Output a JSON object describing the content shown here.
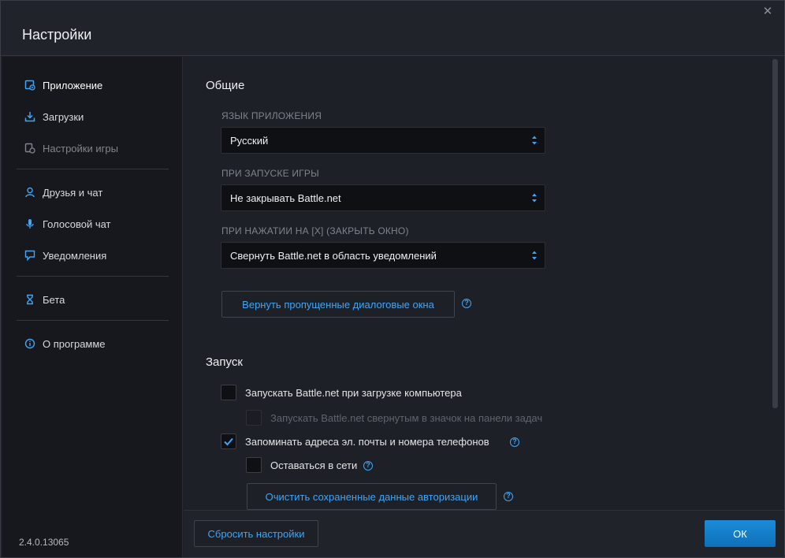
{
  "window": {
    "title": "Настройки",
    "close_symbol": "✕"
  },
  "sidebar": {
    "items": [
      {
        "label": "Приложение",
        "icon": "app-settings-icon",
        "state": "active"
      },
      {
        "label": "Загрузки",
        "icon": "download-icon",
        "state": "normal"
      },
      {
        "label": "Настройки игры",
        "icon": "game-settings-icon",
        "state": "disabled"
      },
      {
        "label": "Друзья и чат",
        "icon": "friends-icon",
        "state": "normal"
      },
      {
        "label": "Голосовой чат",
        "icon": "microphone-icon",
        "state": "normal"
      },
      {
        "label": "Уведомления",
        "icon": "notification-icon",
        "state": "normal"
      },
      {
        "label": "Бета",
        "icon": "beta-flask-icon",
        "state": "normal"
      },
      {
        "label": "О программе",
        "icon": "info-icon",
        "state": "normal"
      }
    ],
    "version": "2.4.0.13065"
  },
  "general": {
    "title": "Общие",
    "language_label": "ЯЗЫК ПРИЛОЖЕНИЯ",
    "language_value": "Русский",
    "launch_label": "ПРИ ЗАПУСКЕ ИГРЫ",
    "launch_value": "Не закрывать Battle.net",
    "close_label": "ПРИ НАЖАТИИ НА [X] (ЗАКРЫТЬ ОКНО)",
    "close_value": "Свернуть Battle.net в область уведомлений",
    "restore_dialogs_button": "Вернуть пропущенные диалоговые окна",
    "help_symbol": "?"
  },
  "startup": {
    "title": "Запуск",
    "launch_on_startup": {
      "label": "Запускать Battle.net при загрузке компьютера",
      "checked": false
    },
    "launch_minimized": {
      "label": "Запускать Battle.net свернутым в значок на панели задач",
      "checked": false,
      "disabled": true
    },
    "remember_email": {
      "label": "Запоминать адреса эл. почты и номера телефонов",
      "checked": true
    },
    "stay_logged_in": {
      "label": "Оставаться в сети",
      "checked": false
    },
    "clear_login_button": "Очистить сохраненные данные авторизации"
  },
  "footer": {
    "reset_button": "Сбросить настройки",
    "ok_button": "ОК"
  },
  "colors": {
    "accent": "#3fa5f5",
    "ok_button": "#1282cc",
    "background": "#1e2027",
    "sidebar": "#16181d"
  }
}
